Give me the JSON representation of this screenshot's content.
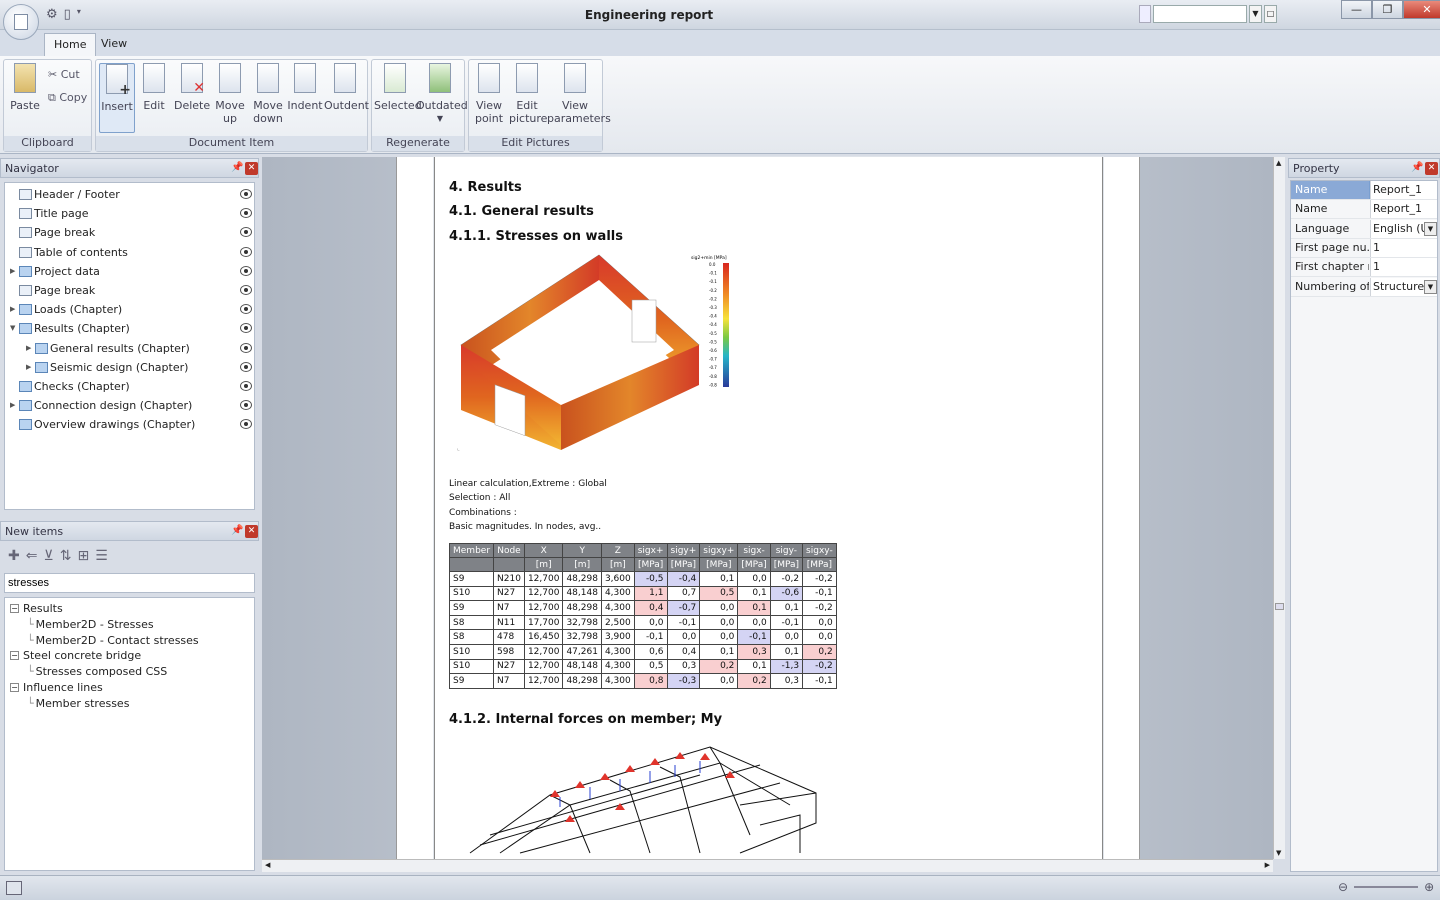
{
  "app": {
    "title": "Engineering report"
  },
  "tabs": [
    "Home",
    "View"
  ],
  "ribbon": {
    "clipboard": {
      "label": "Clipboard",
      "paste": "Paste",
      "cut": "Cut",
      "copy": "Copy"
    },
    "document_item": {
      "label": "Document Item",
      "insert": "Insert",
      "edit": "Edit",
      "delete": "Delete",
      "move_up": "Move up",
      "move_down": "Move down",
      "indent": "Indent",
      "outdent": "Outdent"
    },
    "regenerate": {
      "label": "Regenerate",
      "selected": "Selected",
      "outdated": "Outdated"
    },
    "edit_pictures": {
      "label": "Edit Pictures",
      "view_point": "View point",
      "edit_picture": "Edit picture",
      "view_parameters": "View parameters"
    }
  },
  "navigator": {
    "title": "Navigator",
    "items": [
      {
        "label": "Header / Footer",
        "type": "page",
        "expand": ""
      },
      {
        "label": "Title page",
        "type": "page",
        "expand": ""
      },
      {
        "label": "Page break",
        "type": "page",
        "expand": ""
      },
      {
        "label": "Table of contents",
        "type": "page",
        "expand": ""
      },
      {
        "label": "Project data",
        "type": "folder",
        "expand": "▶"
      },
      {
        "label": "Page break",
        "type": "page",
        "expand": ""
      },
      {
        "label": "Loads (Chapter)",
        "type": "folder",
        "expand": "▶"
      },
      {
        "label": "Results (Chapter)",
        "type": "folder",
        "expand": "▼"
      },
      {
        "label": "General results (Chapter)",
        "type": "folder",
        "expand": "▶",
        "indent": 1
      },
      {
        "label": "Seismic design (Chapter)",
        "type": "folder",
        "expand": "▶",
        "indent": 1
      },
      {
        "label": "Checks (Chapter)",
        "type": "folder",
        "expand": ""
      },
      {
        "label": "Connection design (Chapter)",
        "type": "folder",
        "expand": "▶"
      },
      {
        "label": "Overview drawings (Chapter)",
        "type": "folder",
        "expand": ""
      }
    ]
  },
  "new_items": {
    "title": "New items",
    "search_value": "stresses",
    "tree": [
      {
        "label": "Results",
        "level": 0,
        "box": "−"
      },
      {
        "label": "Member2D - Stresses",
        "level": 1
      },
      {
        "label": "Member2D - Contact stresses",
        "level": 1
      },
      {
        "label": "Steel concrete bridge",
        "level": 0,
        "box": "−"
      },
      {
        "label": "Stresses composed CSS",
        "level": 1
      },
      {
        "label": "Influence lines",
        "level": 0,
        "box": "−"
      },
      {
        "label": "Member stresses",
        "level": 1
      }
    ]
  },
  "document": {
    "h1": "4. Results",
    "h2": "4.1. General results",
    "h3": "4.1.1. Stresses on walls",
    "legend_title": "sig2+min [MPa]",
    "legend_values": [
      "0.0",
      "-0.1",
      "-0.1",
      "-0.2",
      "-0.2",
      "-0.3",
      "-0.4",
      "-0.4",
      "-0.5",
      "-0.5",
      "-0.6",
      "-0.7",
      "-0.7",
      "-0.8",
      "-0.8"
    ],
    "notes": [
      "Linear calculation,Extreme  : Global",
      "Selection : All",
      "Combinations :",
      "Basic magnitudes.  In nodes, avg.."
    ],
    "table": {
      "headers": [
        [
          "Member",
          ""
        ],
        [
          "Node",
          ""
        ],
        [
          "X",
          "[m]"
        ],
        [
          "Y",
          "[m]"
        ],
        [
          "Z",
          "[m]"
        ],
        [
          "sigx+",
          "[MPa]"
        ],
        [
          "sigy+",
          "[MPa]"
        ],
        [
          "sigxy+",
          "[MPa]"
        ],
        [
          "sigx-",
          "[MPa]"
        ],
        [
          "sigy-",
          "[MPa]"
        ],
        [
          "sigxy-",
          "[MPa]"
        ]
      ],
      "rows": [
        [
          "S9",
          "N210",
          "12,700",
          "48,298",
          "3,600",
          "-0,5",
          "-0,4",
          "0,1",
          "0,0",
          "-0,2",
          "-0,2"
        ],
        [
          "S10",
          "N27",
          "12,700",
          "48,148",
          "4,300",
          "1,1",
          "0,7",
          "0,5",
          "0,1",
          "-0,6",
          "-0,1"
        ],
        [
          "S9",
          "N7",
          "12,700",
          "48,298",
          "4,300",
          "0,4",
          "-0,7",
          "0,0",
          "0,1",
          "0,1",
          "-0,2"
        ],
        [
          "S8",
          "N11",
          "17,700",
          "32,798",
          "2,500",
          "0,0",
          "-0,1",
          "0,0",
          "0,0",
          "-0,1",
          "0,0"
        ],
        [
          "S8",
          "478",
          "16,450",
          "32,798",
          "3,900",
          "-0,1",
          "0,0",
          "0,0",
          "-0,1",
          "0,0",
          "0,0"
        ],
        [
          "S10",
          "598",
          "12,700",
          "47,261",
          "4,300",
          "0,6",
          "0,4",
          "0,1",
          "0,3",
          "0,1",
          "0,2"
        ],
        [
          "S10",
          "N27",
          "12,700",
          "48,148",
          "4,300",
          "0,5",
          "0,3",
          "0,2",
          "0,1",
          "-1,3",
          "-0,2"
        ],
        [
          "S9",
          "N7",
          "12,700",
          "48,298",
          "4,300",
          "0,8",
          "-0,3",
          "0,0",
          "0,2",
          "0,3",
          "-0,1"
        ]
      ],
      "highlights": [
        [
          "",
          "",
          "",
          "",
          "",
          "b",
          "b",
          "",
          "",
          "",
          ""
        ],
        [
          "",
          "",
          "",
          "",
          "",
          "r",
          "",
          "r",
          "",
          "b",
          ""
        ],
        [
          "",
          "",
          "",
          "",
          "",
          "r",
          "b",
          "",
          "r",
          "",
          ""
        ],
        [
          "",
          "",
          "",
          "",
          "",
          "",
          "",
          "",
          "",
          "",
          ""
        ],
        [
          "",
          "",
          "",
          "",
          "",
          "",
          "",
          "",
          "b",
          "",
          ""
        ],
        [
          "",
          "",
          "",
          "",
          "",
          "",
          "",
          "",
          "r",
          "",
          "r"
        ],
        [
          "",
          "",
          "",
          "",
          "",
          "",
          "",
          "r",
          "",
          "b",
          "b"
        ],
        [
          "",
          "",
          "",
          "",
          "",
          "r",
          "b",
          "",
          "r",
          "",
          ""
        ]
      ]
    },
    "h4": "4.1.2. Internal forces on member; My"
  },
  "property": {
    "title": "Property",
    "header": {
      "key": "Name",
      "value": "Report_1"
    },
    "rows": [
      {
        "key": "Name",
        "value": "Report_1",
        "dropdown": false
      },
      {
        "key": "Language",
        "value": "English (Un",
        "dropdown": true
      },
      {
        "key": "First page nu...",
        "value": "1",
        "dropdown": false
      },
      {
        "key": "First chapter n...",
        "value": "1",
        "dropdown": false
      },
      {
        "key": "Numbering of ...",
        "value": "Structured",
        "dropdown": true
      }
    ]
  },
  "icons": {
    "app": "app-menu-icon",
    "gear": "gear-icon",
    "eye": "visibility-eye-icon",
    "pin": "pin-icon",
    "close": "close-icon"
  },
  "colors": {
    "accent": "#7a9fd0",
    "close": "#c0392b",
    "highlight_red": "#f9cfd0",
    "highlight_blue": "#d4d4f4"
  }
}
